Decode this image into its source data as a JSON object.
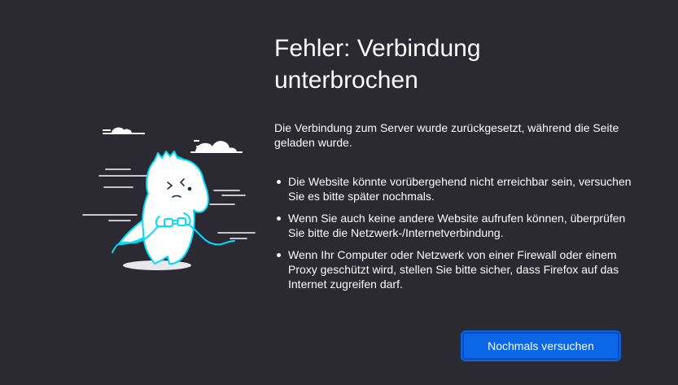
{
  "error": {
    "title_line1": "Fehler: Verbindung",
    "title_line2": "unterbrochen",
    "description": "Die Verbindung zum Server wurde zurückgesetzt, während die Seite geladen wurde.",
    "reasons": [
      "Die Website könnte vorübergehend nicht erreichbar sein, versuchen Sie es bitte später nochmals.",
      "Wenn Sie auch keine andere Website aufrufen können, überprüfen Sie bitte die Netzwerk-/Internetverbindung.",
      "Wenn Ihr Computer oder Netzwerk von einer Firewall oder einem Proxy geschützt wird, stellen Sie bitte sicher, dass Firefox auf das Internet zugreifen darf."
    ],
    "retry_label": "Nochmals versuchen"
  },
  "illustration": {
    "name": "unplugged-dinosaur-illustration",
    "body_color": "#ffffff",
    "outline_color": "#00ddff"
  },
  "colors": {
    "background": "#2b2a33",
    "text": "#fbfbfe",
    "button_bg": "#0b66e8"
  }
}
